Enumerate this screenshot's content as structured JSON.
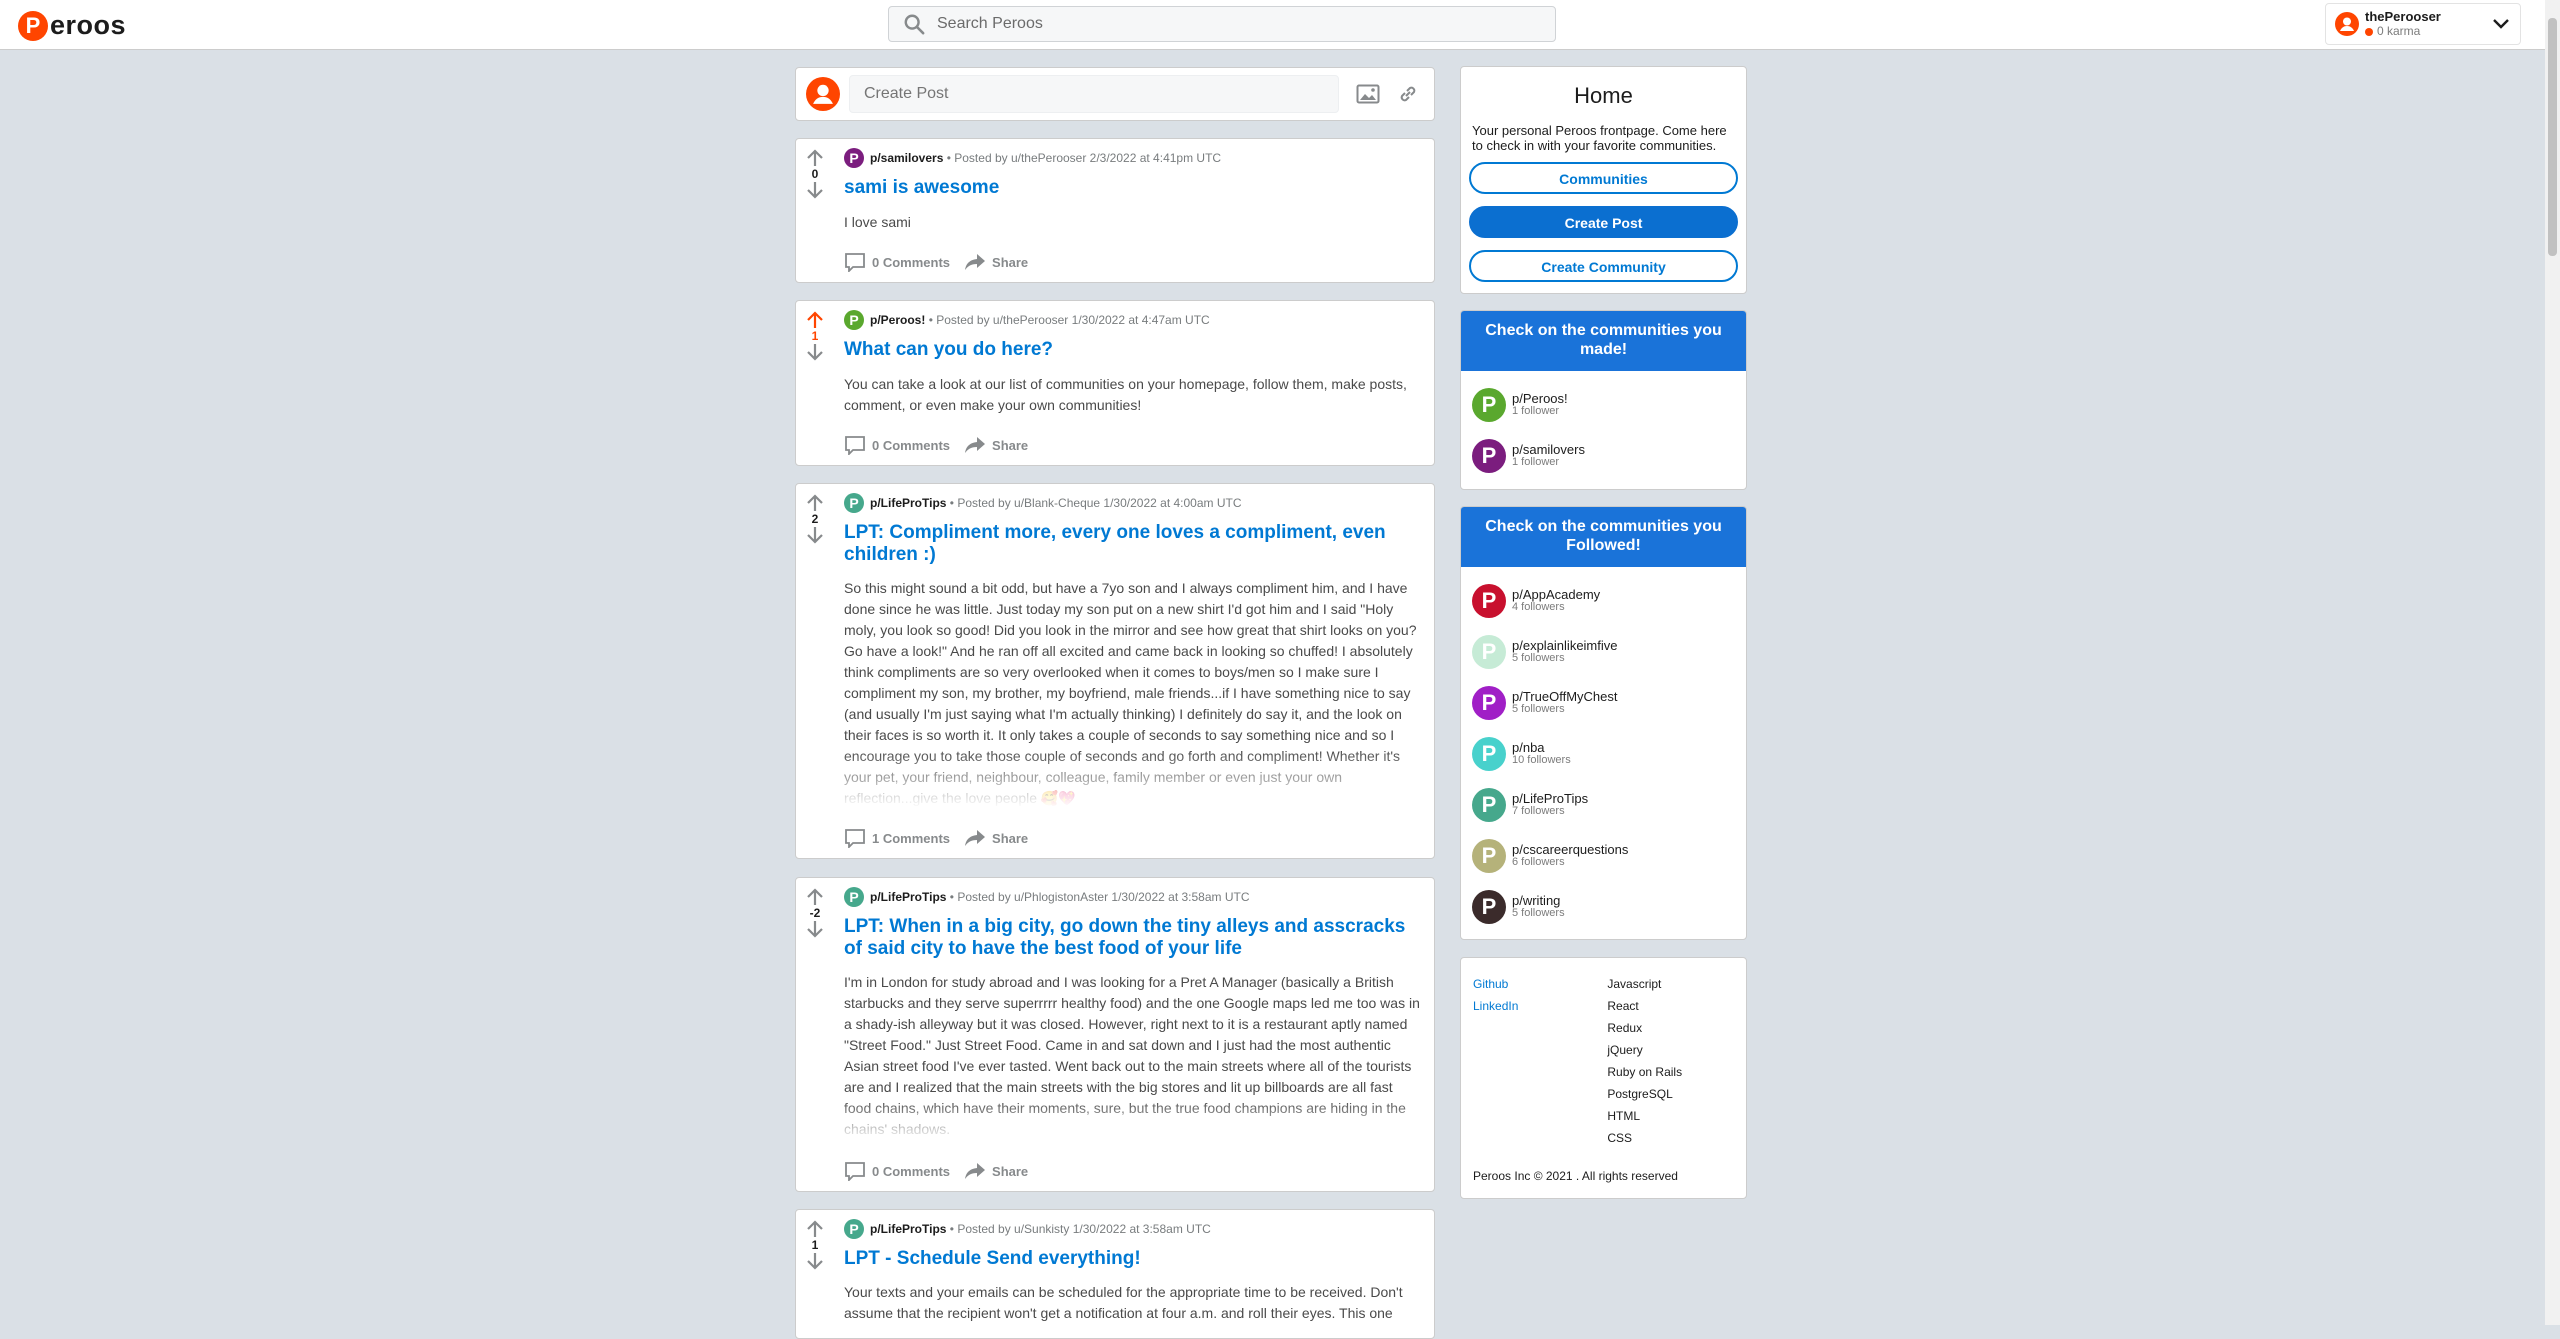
{
  "header": {
    "logo_letter": "P",
    "logo_text": "eroos",
    "search_placeholder": "Search Peroos",
    "user": {
      "name": "thePerooser",
      "karma": "0 karma"
    }
  },
  "create_post": {
    "placeholder": "Create Post"
  },
  "labels": {
    "share": "Share"
  },
  "posts": [
    {
      "community": "p/samilovers",
      "meta": "• Posted by u/thePerooser 2/3/2022 at 4:41pm UTC",
      "votes": "0",
      "title": "sami is awesome",
      "text": "I love sami",
      "comments": "0 Comments",
      "icon_color": "#7b1d7e"
    },
    {
      "community": "p/Peroos!",
      "meta": "• Posted by u/thePerooser 1/30/2022 at 4:47am UTC",
      "votes": "1",
      "title": "What can you do here?",
      "text": "You can take a look at our list of communities on your homepage, follow them, make posts, comment, or even make your own communities!",
      "comments": "0 Comments",
      "icon_color": "#5aa82e"
    },
    {
      "community": "p/LifeProTips",
      "meta": "• Posted by u/Blank-Cheque 1/30/2022 at 4:00am UTC",
      "votes": "2",
      "title": "LPT: Compliment more, every one loves a compliment, even children :)",
      "text": "So this might sound a bit odd, but have a 7yo son and I always compliment him, and I have done since he was little. Just today my son put on a new shirt I'd got him and I said \"Holy moly, you look so good! Did you look in the mirror and see how great that shirt looks on you? Go have a look!\" And he ran off all excited and came back in looking so chuffed! I absolutely think compliments are so very overlooked when it comes to boys/men so I make sure I compliment my son, my brother, my boyfriend, male friends...if I have something nice to say (and usually I'm just saying what I'm actually thinking) I definitely do say it, and the look on their faces is so worth it. It only takes a couple of seconds to say something nice and so I encourage you to take those couple of seconds and go forth and compliment! Whether it's your pet, your friend, neighbour, colleague, family member or even just your own reflection...give the love people 🥰💖",
      "comments": "1 Comments",
      "icon_color": "#46a88c"
    },
    {
      "community": "p/LifeProTips",
      "meta": "• Posted by u/PhlogistonAster 1/30/2022 at 3:58am UTC",
      "votes": "-2",
      "title": "LPT: When in a big city, go down the tiny alleys and asscracks of said city to have the best food of your life",
      "text": "I'm in London for study abroad and I was looking for a Pret A Manager (basically a British starbucks and they serve superrrrr healthy food) and the one Google maps led me too was in a shady-ish alleyway but it was closed. However, right next to it is a restaurant aptly named \"Street Food.\" Just Street Food. Came in and sat down and I just had the most authentic Asian street food I've ever tasted. Went back out to the main streets where all of the tourists are and I realized that the main streets with the big stores and lit up billboards are all fast food chains, which have their moments, sure, but the true food champions are hiding in the chains' shadows.",
      "comments": "0 Comments",
      "icon_color": "#46a88c"
    },
    {
      "community": "p/LifeProTips",
      "meta": "• Posted by u/Sunkisty 1/30/2022 at 3:58am UTC",
      "votes": "1",
      "title": "LPT - Schedule Send everything!",
      "text": "Your texts and your emails can be scheduled for the appropriate time to be received. Don't assume that the recipient won't get a notification at four a.m. and roll their eyes. This one",
      "comments": "",
      "icon_color": "#46a88c"
    }
  ],
  "sidebar": {
    "home_title": "Home",
    "home_desc": "Your personal Peroos frontpage. Come here to check in with your favorite communities.",
    "btn_communities": "Communities",
    "btn_create_post": "Create Post",
    "btn_create_community": "Create Community",
    "made_heading": "Check on the communities you made!",
    "made": [
      {
        "name": "p/Peroos!",
        "followers": "1 follower",
        "color": "#5aa82e"
      },
      {
        "name": "p/samilovers",
        "followers": "1 follower",
        "color": "#7b1d7e"
      }
    ],
    "followed_heading": "Check on the communities you Followed!",
    "followed": [
      {
        "name": "p/AppAcademy",
        "followers": "4 followers",
        "color": "#c8102e"
      },
      {
        "name": "p/explainlikeimfive",
        "followers": "5 followers",
        "color": "#c6ebd6"
      },
      {
        "name": "p/TrueOffMyChest",
        "followers": "5 followers",
        "color": "#a01fc6"
      },
      {
        "name": "p/nba",
        "followers": "10 followers",
        "color": "#48d1cc"
      },
      {
        "name": "p/LifeProTips",
        "followers": "7 followers",
        "color": "#46a88c"
      },
      {
        "name": "p/cscareerquestions",
        "followers": "6 followers",
        "color": "#b5b27a"
      },
      {
        "name": "p/writing",
        "followers": "5 followers",
        "color": "#3b2b2b"
      }
    ]
  },
  "footer": {
    "links": [
      "Github",
      "LinkedIn"
    ],
    "tech": [
      "Javascript",
      "React",
      "Redux",
      "jQuery",
      "Ruby on Rails",
      "PostgreSQL",
      "HTML",
      "CSS"
    ],
    "copyright": "Peroos Inc © 2021 . All rights reserved"
  }
}
